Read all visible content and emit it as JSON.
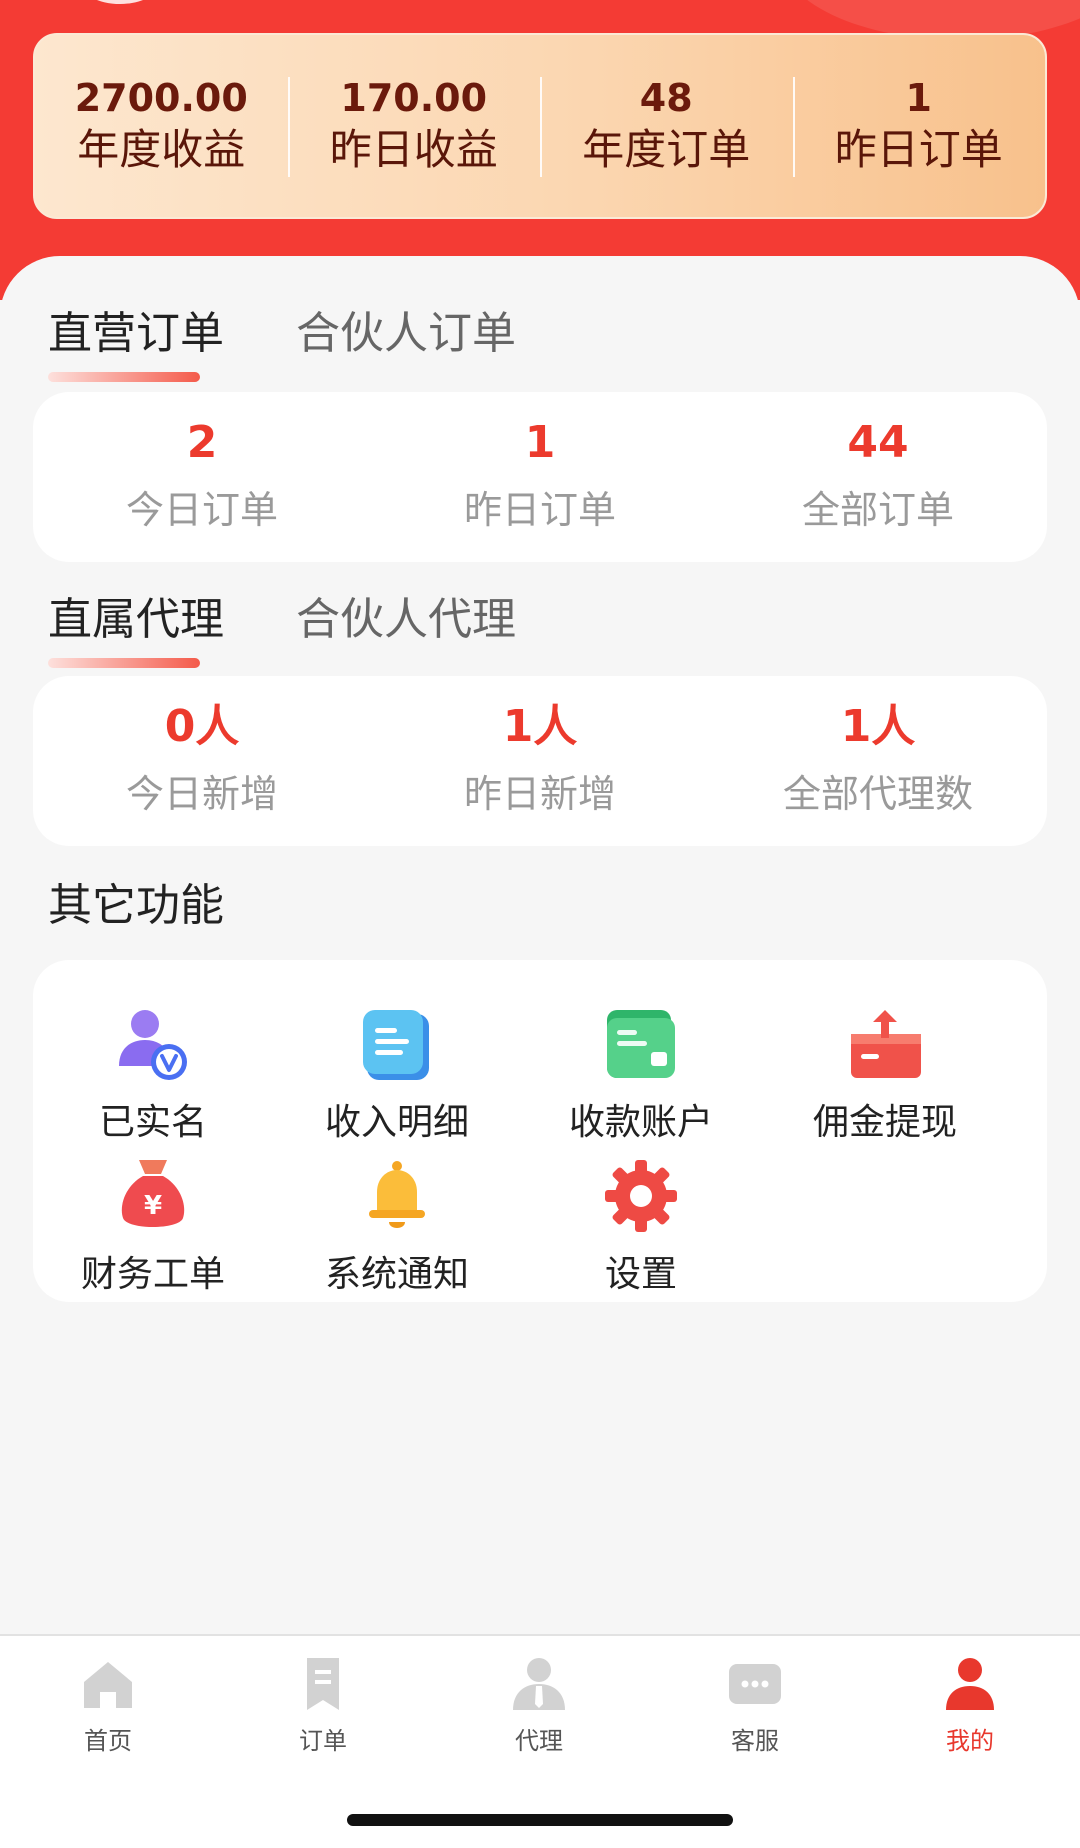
{
  "header": {
    "stats": [
      {
        "value": "2700.00",
        "label": "年度收益"
      },
      {
        "value": "170.00",
        "label": "昨日收益"
      },
      {
        "value": "48",
        "label": "年度订单"
      },
      {
        "value": "1",
        "label": "昨日订单"
      }
    ]
  },
  "orders": {
    "tabs": [
      {
        "label": "直营订单",
        "active": true
      },
      {
        "label": "合伙人订单",
        "active": false
      }
    ],
    "metrics": [
      {
        "value": "2",
        "label": "今日订单"
      },
      {
        "value": "1",
        "label": "昨日订单"
      },
      {
        "value": "44",
        "label": "全部订单"
      }
    ]
  },
  "agents": {
    "tabs": [
      {
        "label": "直属代理",
        "active": true
      },
      {
        "label": "合伙人代理",
        "active": false
      }
    ],
    "metrics": [
      {
        "value": "0人",
        "label": "今日新增"
      },
      {
        "value": "1人",
        "label": "昨日新增"
      },
      {
        "value": "1人",
        "label": "全部代理数"
      }
    ]
  },
  "functions": {
    "title": "其它功能",
    "items": [
      {
        "label": "已实名",
        "icon": "verified-user-icon"
      },
      {
        "label": "收入明细",
        "icon": "income-detail-icon"
      },
      {
        "label": "收款账户",
        "icon": "wallet-icon"
      },
      {
        "label": "佣金提现",
        "icon": "withdraw-icon"
      },
      {
        "label": "财务工单",
        "icon": "money-bag-icon"
      },
      {
        "label": "系统通知",
        "icon": "bell-icon"
      },
      {
        "label": "设置",
        "icon": "gear-icon"
      }
    ]
  },
  "tabbar": {
    "items": [
      {
        "label": "首页",
        "icon": "home-icon",
        "active": false
      },
      {
        "label": "订单",
        "icon": "bookmark-icon",
        "active": false
      },
      {
        "label": "代理",
        "icon": "agent-icon",
        "active": false
      },
      {
        "label": "客服",
        "icon": "chat-icon",
        "active": false
      },
      {
        "label": "我的",
        "icon": "person-icon",
        "active": true
      }
    ]
  },
  "colors": {
    "brand_red": "#f43b34",
    "accent_red": "#ec3a2d",
    "tabbar_active": "#e8382d"
  }
}
